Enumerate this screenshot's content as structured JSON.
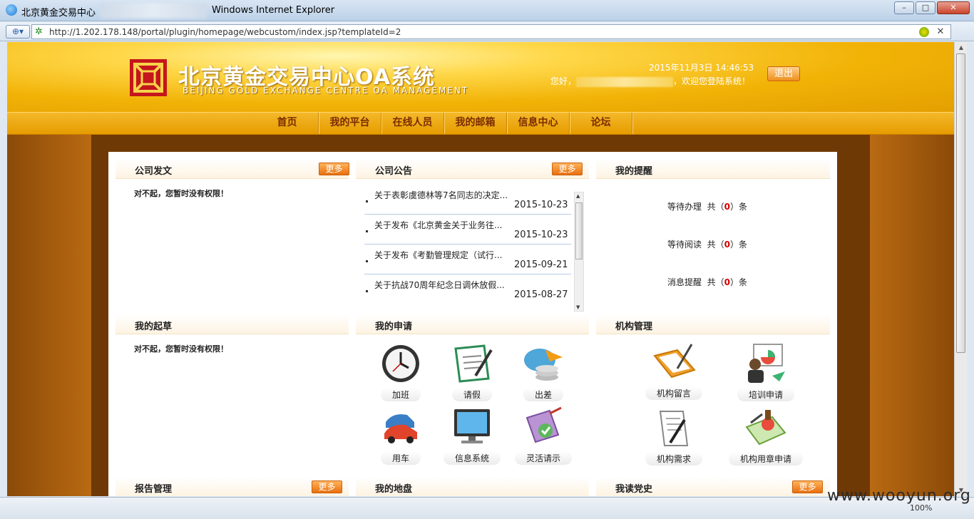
{
  "window": {
    "tab_title": "北京黄金交易中心",
    "app_name": "Windows Internet Explorer",
    "min": "–",
    "max": "□",
    "close": "✕"
  },
  "address": {
    "url": "http://1.202.178.148/portal/plugin/homepage/webcustom/index.jsp?templateId=2"
  },
  "header": {
    "title_cn": "北京黄金交易中心OA系统",
    "title_en": "BEIJING GOLD EXCHANGE CENTRE OA MANAGEMENT",
    "datetime": "2015年11月3日 14:46:53",
    "greeting_prefix": "您好，",
    "greeting_suffix": "，欢迎您登陆系统！",
    "logout": "退出"
  },
  "nav": [
    "首页",
    "我的平台",
    "在线人员",
    "我的邮箱",
    "信息中心",
    "论坛"
  ],
  "portlets": {
    "company_docs": {
      "title": "公司发文",
      "more": "更多",
      "message": "对不起，您暂时没有权限！"
    },
    "announcements": {
      "title": "公司公告",
      "more": "更多",
      "items": [
        {
          "title": "关于表彰虞德林等7名同志的决定...",
          "date": "2015-10-23"
        },
        {
          "title": "关于发布《北京黄金关于业务往...",
          "date": "2015-10-23"
        },
        {
          "title": "关于发布《考勤管理规定（试行...",
          "date": "2015-09-21"
        },
        {
          "title": "关于抗战70周年纪念日调休放假...",
          "date": "2015-08-27"
        }
      ]
    },
    "reminders": {
      "title": "我的提醒",
      "rows": [
        {
          "label": "等待办理",
          "prefix": "共（",
          "count": "0",
          "suffix": "）条"
        },
        {
          "label": "等待阅读",
          "prefix": "共（",
          "count": "0",
          "suffix": "）条"
        },
        {
          "label": "消息提醒",
          "prefix": "共（",
          "count": "0",
          "suffix": "）条"
        }
      ]
    },
    "drafts": {
      "title": "我的起草",
      "message": "对不起，您暂时没有权限！"
    },
    "applications": {
      "title": "我的申请",
      "apps": [
        {
          "label": "加班",
          "icon": "clock-icon"
        },
        {
          "label": "请假",
          "icon": "leave-form-icon"
        },
        {
          "label": "出差",
          "icon": "travel-coins-icon"
        },
        {
          "label": "用车",
          "icon": "car-icon"
        },
        {
          "label": "信息系统",
          "icon": "monitor-icon"
        },
        {
          "label": "灵活请示",
          "icon": "clipboard-icon"
        }
      ]
    },
    "org_management": {
      "title": "机构管理",
      "apps": [
        {
          "label": "机构留言",
          "icon": "folder-pen-icon"
        },
        {
          "label": "培训申请",
          "icon": "presentation-icon"
        },
        {
          "label": "机构需求",
          "icon": "document-pen-icon"
        },
        {
          "label": "机构用章申请",
          "icon": "stamp-icon"
        }
      ]
    },
    "reports": {
      "title": "报告管理",
      "more": "更多"
    },
    "territory": {
      "title": "我的地盘"
    },
    "party_history": {
      "title": "我读党史",
      "more": "更多"
    }
  },
  "status": {
    "zoom": "100%"
  },
  "watermark": "www.wooyun.org",
  "colors": {
    "gold": "#f2b307",
    "brown": "#6f3906",
    "nav_text": "#7a2c00",
    "more_btn": "#e96f0e",
    "alert": "#d40000"
  }
}
